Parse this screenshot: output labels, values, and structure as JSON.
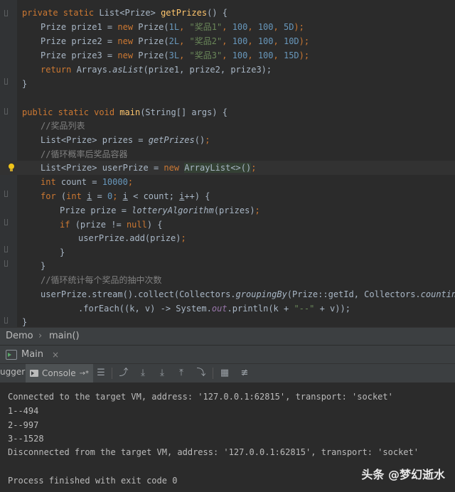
{
  "editor": {
    "l1": {
      "kw1": "private static ",
      "t1": "List<Prize> ",
      "fn": "getPrizes",
      "t2": "() {"
    },
    "l2": {
      "a": "Prize prize1 = ",
      "kw": "new ",
      "b": "Prize(",
      "n1": "1L",
      "c": ", ",
      "s": "\"奖品1\"",
      "d": ", ",
      "n2": "100",
      "e": ", ",
      "n3": "100",
      "f": ", ",
      "n4": "5D",
      "g": ");"
    },
    "l3": {
      "a": "Prize prize2 = ",
      "kw": "new ",
      "b": "Prize(",
      "n1": "2L",
      "c": ", ",
      "s": "\"奖品2\"",
      "d": ", ",
      "n2": "100",
      "e": ", ",
      "n3": "100",
      "f": ", ",
      "n4": "10D",
      "g": ");"
    },
    "l4": {
      "a": "Prize prize3 = ",
      "kw": "new ",
      "b": "Prize(",
      "n1": "3L",
      "c": ", ",
      "s": "\"奖品3\"",
      "d": ", ",
      "n2": "100",
      "e": ", ",
      "n3": "100",
      "f": ", ",
      "n4": "15D",
      "g": ");"
    },
    "l5": {
      "kw": "return ",
      "a": "Arrays.",
      "it": "asList",
      "b": "(prize1, prize2, prize3);"
    },
    "l6": "}",
    "l8": {
      "kw": "public static void ",
      "fn": "main",
      "a": "(String[] args) {"
    },
    "l9": "//奖品列表",
    "l10": {
      "a": "List<Prize> prizes = ",
      "it": "getPrizes",
      "b": "()",
      "c": ";"
    },
    "l11": "//循环概率后奖品容器",
    "l12": {
      "a": "List<Prize> userPrize = ",
      "kw": "new ",
      "b": "ArrayList<>()",
      "c": ";"
    },
    "l13": {
      "kw": "int ",
      "a": "count = ",
      "n": "10000",
      "b": ";"
    },
    "l14": {
      "kw": "for ",
      "a": "(",
      "kw2": "int ",
      "i1": "i",
      "b": " = ",
      "n": "0",
      "c": "; ",
      "i2": "i",
      "d": " < count; ",
      "i3": "i",
      "e": "++) {"
    },
    "l15": {
      "a": "Prize prize = ",
      "it": "lotteryAlgorithm",
      "b": "(prizes)",
      "c": ";"
    },
    "l16": {
      "kw": "if ",
      "a": "(prize != ",
      "kw2": "null",
      "b": ") {"
    },
    "l17": {
      "a": "userPrize.add(prize)",
      "b": ";"
    },
    "l18": "}",
    "l19": "}",
    "l20": "//循环统计每个奖品的抽中次数",
    "l21": {
      "a": "userPrize.stream().collect(Collectors.",
      "it1": "groupingBy",
      "b": "(Prize::getId, Collectors.",
      "it2": "counting",
      "c": "()))"
    },
    "l22": {
      "a": ".forEach((k, v) -> System.",
      "sf": "out",
      "b": ".println(k + ",
      "s": "\"--\"",
      "c": " + v));"
    },
    "l23": "}"
  },
  "breadcrumb": {
    "class": "Demo",
    "sep": "›",
    "method": "main()"
  },
  "run_tab": {
    "label": "Main",
    "close": "×"
  },
  "toolbar": {
    "debugger": "ugger",
    "console": "Console",
    "console_arrow": "→*"
  },
  "console": {
    "lines": [
      "Connected to the target VM, address: '127.0.0.1:62815', transport: 'socket'",
      "1--494",
      "2--997",
      "3--1528",
      "Disconnected from the target VM, address: '127.0.0.1:62815', transport: 'socket'",
      "",
      "Process finished with exit code 0"
    ]
  },
  "watermark": "头条 @梦幻逝水"
}
